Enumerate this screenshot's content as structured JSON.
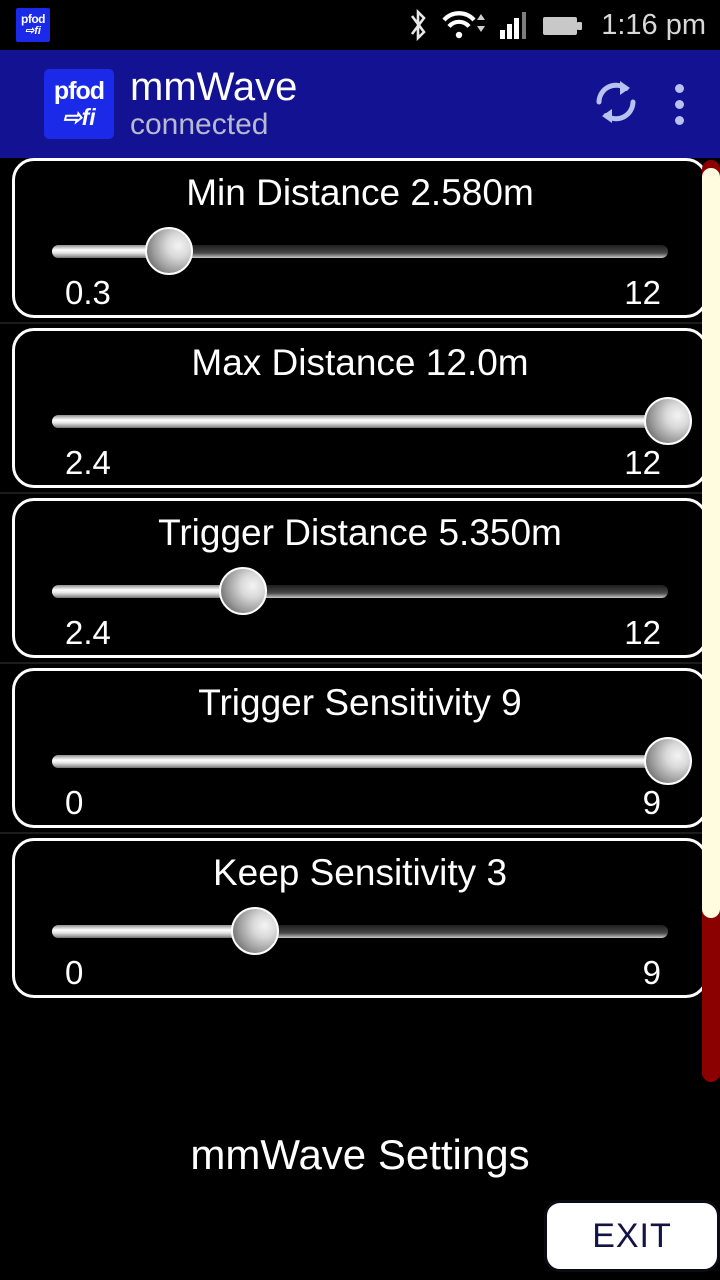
{
  "status_bar": {
    "app_icon": {
      "line1": "pfod",
      "line2": "⇨fi",
      "icon_name": "pfod-notification-icon"
    },
    "icons": [
      "bluetooth-icon",
      "wifi-icon",
      "cell-signal-icon",
      "battery-icon"
    ],
    "time": "1:16 pm"
  },
  "app_bar": {
    "logo": {
      "line1": "pfod",
      "line2": "⇨fi"
    },
    "title": "mmWave",
    "subtitle": "connected",
    "refresh_icon": "refresh-icon",
    "overflow_icon": "overflow-menu-icon",
    "background_color": "#121292",
    "logo_color": "#1a2ae8"
  },
  "sliders": [
    {
      "title": "Min Distance 2.580m",
      "label": "Min Distance",
      "value": "2.580m",
      "min": "0.3",
      "max": "12",
      "percent": 19
    },
    {
      "title": "Max Distance 12.0m",
      "label": "Max Distance",
      "value": "12.0m",
      "min": "2.4",
      "max": "12",
      "percent": 100
    },
    {
      "title": "Trigger Distance 5.350m",
      "label": "Trigger Distance",
      "value": "5.350m",
      "min": "2.4",
      "max": "12",
      "percent": 31
    },
    {
      "title": "Trigger Sensitivity 9",
      "label": "Trigger Sensitivity",
      "value": "9",
      "min": "0",
      "max": "9",
      "percent": 100
    },
    {
      "title": "Keep Sensitivity 3",
      "label": "Keep Sensitivity",
      "value": "3",
      "min": "0",
      "max": "9",
      "percent": 33
    }
  ],
  "scrollbar": {
    "thumb_color": "#fffce0",
    "track_color": "#8b0000"
  },
  "footer": {
    "title": "mmWave Settings",
    "exit_label": "EXIT",
    "exit_text_color": "#131345"
  }
}
